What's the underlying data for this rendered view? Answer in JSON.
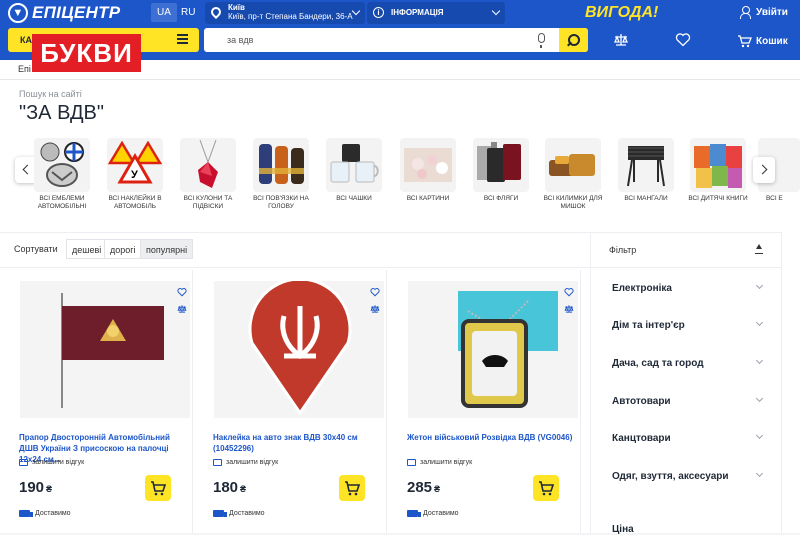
{
  "header": {
    "logo": "ЕПІЦЕНТР",
    "lang_ua": "UA",
    "lang_ru": "RU",
    "city": "Київ",
    "address": "Київ, пр-т Степана Бандери, 36-А",
    "info": "ІНФОРМАЦІЯ",
    "promo": "ВИГОДА!",
    "login": "Увійти",
    "catalog": "КА",
    "overlay": "БУКВИ",
    "search_value": "за вдв",
    "cart": "Кошик"
  },
  "breadcrumb": "Епі",
  "page": {
    "subtitle": "Пошук на сайті",
    "title": "\"ЗА ВДВ\""
  },
  "categories": [
    "ВСІ ЕМБЛЕМИ АВТОМОБІЛЬНІ",
    "ВСІ НАКЛЕЙКИ В АВТОМОБІЛЬ",
    "ВСІ КУЛОНИ ТА ПІДВІСКИ",
    "ВСІ ПОВ'ЯЗКИ НА ГОЛОВУ",
    "ВСІ ЧАШКИ",
    "ВСІ КАРТИНИ",
    "ВСІ ФЛЯГИ",
    "ВСІ КИЛИМКИ ДЛЯ МИШОК",
    "ВСІ МАНГАЛИ",
    "ВСІ ДИТЯЧІ КНИГИ",
    "ВСІ Е"
  ],
  "sort": {
    "label": "Сортувати",
    "options": [
      "дешеві",
      "дорогі",
      "популярні"
    ]
  },
  "filter": {
    "title": "Фільтр",
    "groups": [
      "Електроніка",
      "Дім та інтер'єр",
      "Дача, сад та город",
      "Автотовари",
      "Канцтовари",
      "Одяг, взуття, аксесуари"
    ],
    "price": "Ціна"
  },
  "products": [
    {
      "name": "Прапор Двосторонній Автомобільний ДШВ України З присоскою на палочці 12х24 см...",
      "review": "залишити відгук",
      "price": "190",
      "currency": "₴",
      "delivery": "Доставимо"
    },
    {
      "name": "Наклейка на авто знак ВДВ 30х40 см (10452296)",
      "review": "залишити відгук",
      "price": "180",
      "currency": "₴",
      "delivery": "Доставимо"
    },
    {
      "name": "Жетон військовий Розвідка ВДВ (VG0046)",
      "review": "залишити відгук",
      "price": "285",
      "currency": "₴",
      "delivery": "Доставимо"
    }
  ],
  "colors": {
    "brand_blue": "#1d56c9",
    "accent_yellow": "#ffe426",
    "overlay_red": "#e31e24"
  }
}
